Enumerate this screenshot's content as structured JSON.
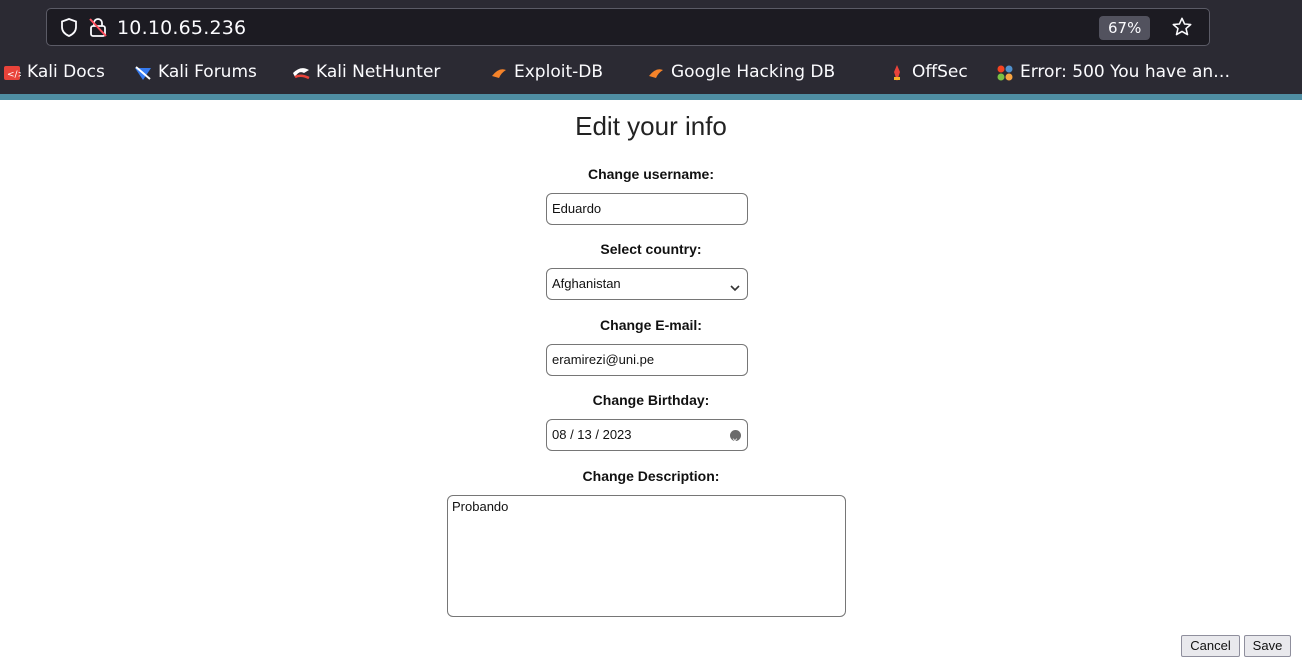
{
  "browser": {
    "url": "10.10.65.236",
    "zoom": "67%",
    "bookmarks": [
      {
        "label": "Kali Docs",
        "icon": "kali-docs-icon"
      },
      {
        "label": "Kali Forums",
        "icon": "kali-forums-icon"
      },
      {
        "label": "Kali NetHunter",
        "icon": "kali-nethunter-icon"
      },
      {
        "label": "Exploit-DB",
        "icon": "exploit-db-icon"
      },
      {
        "label": "Google Hacking DB",
        "icon": "google-hacking-db-icon"
      },
      {
        "label": "OffSec",
        "icon": "offsec-icon"
      },
      {
        "label": "Error: 500 You have an…",
        "icon": "joomla-icon"
      }
    ]
  },
  "form": {
    "title": "Edit your info",
    "username": {
      "label": "Change username:",
      "value": "Eduardo"
    },
    "country": {
      "label": "Select country:",
      "value": "Afghanistan"
    },
    "email": {
      "label": "Change E-mail:",
      "value": "eramirezi@uni.pe"
    },
    "birthday": {
      "label": "Change Birthday:",
      "value": "08 / 13 / 2023"
    },
    "description": {
      "label": "Change Description:",
      "value": "Probando"
    },
    "cancel_label": "Cancel",
    "save_label": "Save"
  },
  "colors": {
    "chrome_bg": "#2b2a33",
    "urlbar_bg": "#1c1b22",
    "accent_line": "#4f8ea3"
  }
}
